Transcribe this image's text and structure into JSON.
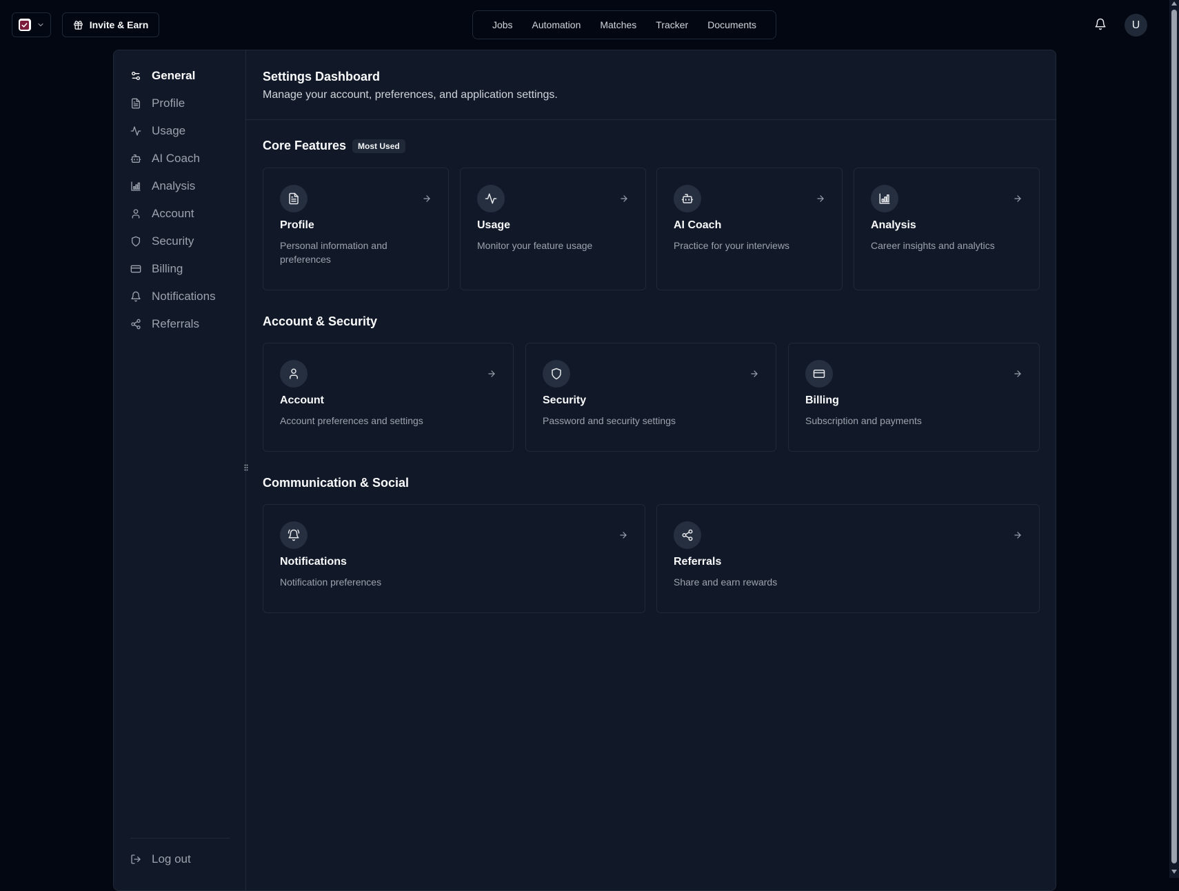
{
  "topbar": {
    "logo_icon": "check-square-icon",
    "invite_label": "Invite & Earn",
    "nav": [
      "Jobs",
      "Automation",
      "Matches",
      "Tracker",
      "Documents"
    ],
    "avatar_initial": "U"
  },
  "sidebar": {
    "items": [
      {
        "label": "General",
        "icon": "sliders-icon",
        "active": true
      },
      {
        "label": "Profile",
        "icon": "file-text-icon"
      },
      {
        "label": "Usage",
        "icon": "activity-icon"
      },
      {
        "label": "AI Coach",
        "icon": "bot-icon"
      },
      {
        "label": "Analysis",
        "icon": "bar-chart-icon"
      },
      {
        "label": "Account",
        "icon": "user-icon"
      },
      {
        "label": "Security",
        "icon": "shield-icon"
      },
      {
        "label": "Billing",
        "icon": "credit-card-icon"
      },
      {
        "label": "Notifications",
        "icon": "bell-icon"
      },
      {
        "label": "Referrals",
        "icon": "share-icon"
      }
    ],
    "logout_label": "Log out"
  },
  "header": {
    "title": "Settings Dashboard",
    "subtitle": "Manage your account, preferences, and application settings."
  },
  "sections": {
    "core": {
      "title": "Core Features",
      "badge": "Most Used",
      "cards": [
        {
          "title": "Profile",
          "desc": "Personal information and preferences",
          "icon": "file-text-icon"
        },
        {
          "title": "Usage",
          "desc": "Monitor your feature usage",
          "icon": "activity-icon"
        },
        {
          "title": "AI Coach",
          "desc": "Practice for your interviews",
          "icon": "bot-icon"
        },
        {
          "title": "Analysis",
          "desc": "Career insights and analytics",
          "icon": "bar-chart-icon"
        }
      ]
    },
    "account": {
      "title": "Account & Security",
      "cards": [
        {
          "title": "Account",
          "desc": "Account preferences and settings",
          "icon": "user-icon"
        },
        {
          "title": "Security",
          "desc": "Password and security settings",
          "icon": "shield-icon"
        },
        {
          "title": "Billing",
          "desc": "Subscription and payments",
          "icon": "credit-card-icon"
        }
      ]
    },
    "social": {
      "title": "Communication & Social",
      "cards": [
        {
          "title": "Notifications",
          "desc": "Notification preferences",
          "icon": "bell-ring-icon"
        },
        {
          "title": "Referrals",
          "desc": "Share and earn rewards",
          "icon": "share-icon"
        }
      ]
    }
  }
}
